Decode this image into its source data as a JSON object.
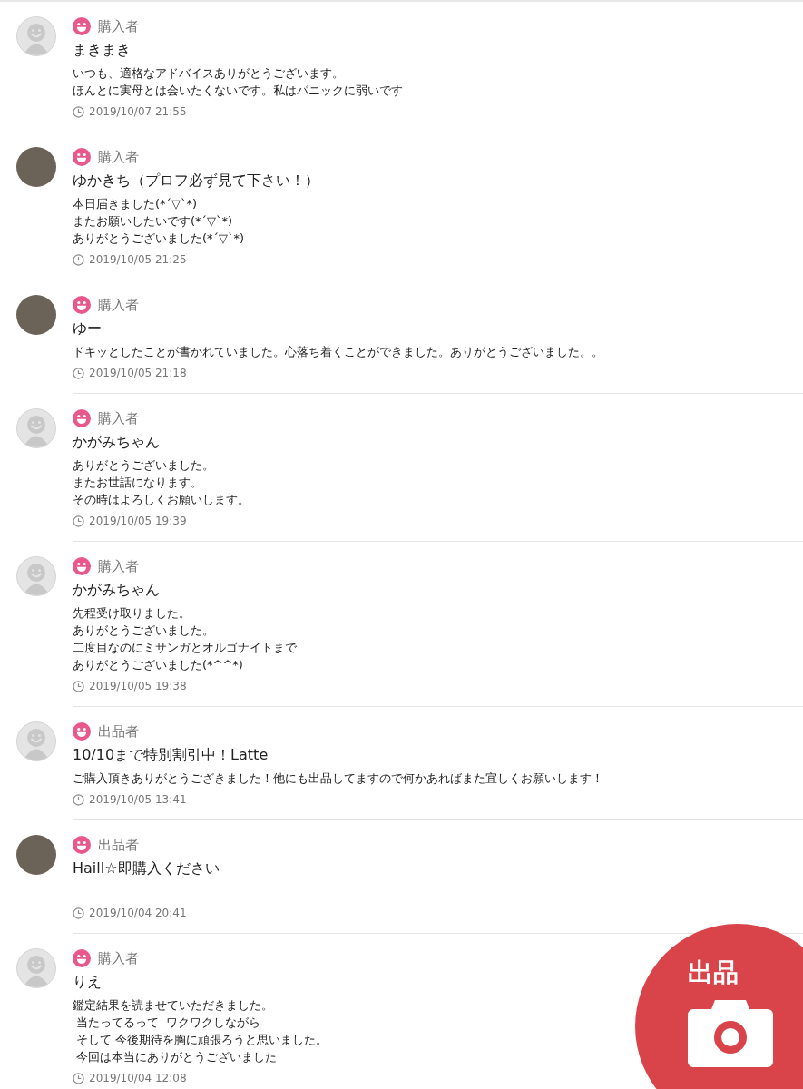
{
  "reviews": [
    {
      "kind": "default",
      "role": "購入者",
      "name": "まきまき",
      "comment": [
        "いつも、適格なアドバイスありがとうございます。",
        "ほんとに実母とは会いたくないです。私はパニックに弱いです"
      ],
      "date": "2019/10/07 21:55"
    },
    {
      "kind": "photo",
      "role": "購入者",
      "name": "ゆかきち（プロフ必ず見て下さい！）",
      "comment": [
        "本日届きました(*´▽`*)",
        "またお願いしたいです(*´▽`*)",
        "ありがとうございました(*´▽`*)"
      ],
      "date": "2019/10/05 21:25"
    },
    {
      "kind": "photo",
      "role": "購入者",
      "name": "ゆー",
      "comment": [
        "ドキッとしたことが書かれていました。心落ち着くことができました。ありがとうございました。。"
      ],
      "date": "2019/10/05 21:18"
    },
    {
      "kind": "default",
      "role": "購入者",
      "name": "かがみちゃん",
      "comment": [
        "ありがとうございました。",
        "またお世話になります。",
        "その時はよろしくお願いします。"
      ],
      "date": "2019/10/05 19:39"
    },
    {
      "kind": "default",
      "role": "購入者",
      "name": "かがみちゃん",
      "comment": [
        "先程受け取りました。",
        "ありがとうございました。",
        "二度目なのにミサンガとオルゴナイトまで",
        "ありがとうございました(*^^*)"
      ],
      "date": "2019/10/05 19:38"
    },
    {
      "kind": "default",
      "role": "出品者",
      "name": "10/10まで特別割引中！Latte",
      "comment": [
        "ご購入頂きありがとうござきました！他にも出品してますので何かあればまた宜しくお願いします！"
      ],
      "date": "2019/10/05 13:41"
    },
    {
      "kind": "photo",
      "role": "出品者",
      "name": "Haill☆即購入ください",
      "date": "2019/10/04 20:41"
    },
    {
      "kind": "default",
      "role": "購入者",
      "name": "りえ",
      "comment": [
        "鑑定結果を読ませていただきました。",
        " 当たってるって  ワクワクしながら",
        " そして 今後期待を胸に頑張ろうと思いました。",
        " 今回は本当にありがとうございました"
      ],
      "date": "2019/10/04 12:08"
    }
  ],
  "fab": {
    "label": "出品"
  }
}
